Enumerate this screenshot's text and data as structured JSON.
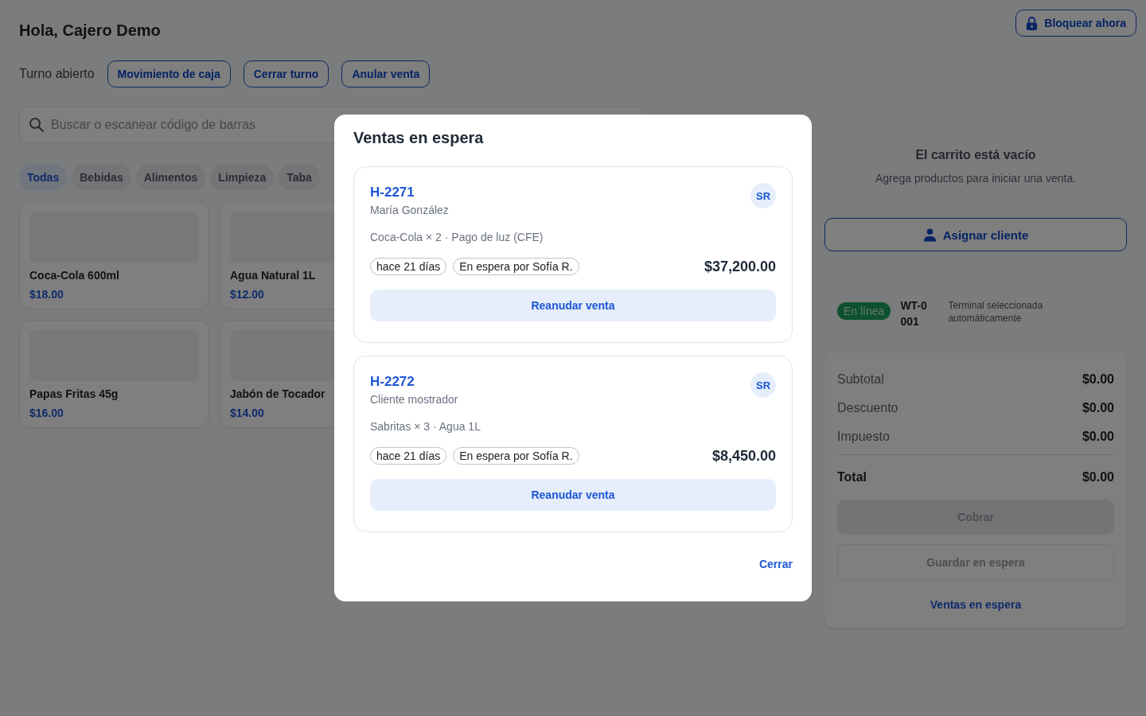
{
  "header": {
    "greeting": "Hola, Cajero Demo",
    "lock_button": "Bloquear ahora"
  },
  "shift": {
    "status": "Turno abierto",
    "actions": [
      "Movimiento de caja",
      "Cerrar turno",
      "Anular venta"
    ]
  },
  "search": {
    "placeholder": "Buscar o escanear código de barras"
  },
  "categories": [
    {
      "label": "Todas",
      "selected": true
    },
    {
      "label": "Bebidas",
      "selected": false
    },
    {
      "label": "Alimentos",
      "selected": false
    },
    {
      "label": "Limpieza",
      "selected": false
    },
    {
      "label": "Taba",
      "selected": false
    }
  ],
  "products": [
    {
      "name": "Coca-Cola 600ml",
      "price": "$18.00"
    },
    {
      "name": "Agua Natural 1L",
      "price": "$12.00"
    },
    {
      "name": "Papas Fritas 45g",
      "price": "$16.00"
    },
    {
      "name": "Jabón de Tocador",
      "price": "$14.00"
    }
  ],
  "cart": {
    "empty_title": "El carrito está vacío",
    "empty_hint": "Agrega productos para iniciar una venta.",
    "assign_button": "Asignar cliente",
    "connection": {
      "label": "En línea",
      "online": true
    },
    "terminal_id": "WT-0001",
    "terminal_note": "Terminal seleccionada automáticamente"
  },
  "summary": {
    "rows": [
      {
        "label": "Subtotal",
        "value": "$0.00"
      },
      {
        "label": "Descuento",
        "value": "$0.00"
      },
      {
        "label": "Impuesto",
        "value": "$0.00"
      }
    ],
    "total": {
      "label": "Total",
      "value": "$0.00"
    },
    "charge_button": {
      "label": "Cobrar",
      "disabled": true
    },
    "hold_button": {
      "label": "Guardar en espera",
      "disabled": true
    },
    "held_link": "Ventas en espera"
  },
  "modal": {
    "title": "Ventas en espera",
    "sales": [
      {
        "id": "H-2271",
        "customer": "María González",
        "items": "Coca-Cola × 2 · Pago de luz (CFE)",
        "age": "hace 21 días",
        "held_by": "En espera por Sofía R.",
        "avatar": "SR",
        "total": "$37,200.00",
        "resume_button": "Reanudar venta"
      },
      {
        "id": "H-2272",
        "customer": "Cliente mostrador",
        "items": "Sabritas × 3 · Agua 1L",
        "age": "hace 21 días",
        "held_by": "En espera por Sofía R.",
        "avatar": "SR",
        "total": "$8,450.00",
        "resume_button": "Reanudar venta"
      }
    ],
    "close_button": "Cerrar"
  }
}
